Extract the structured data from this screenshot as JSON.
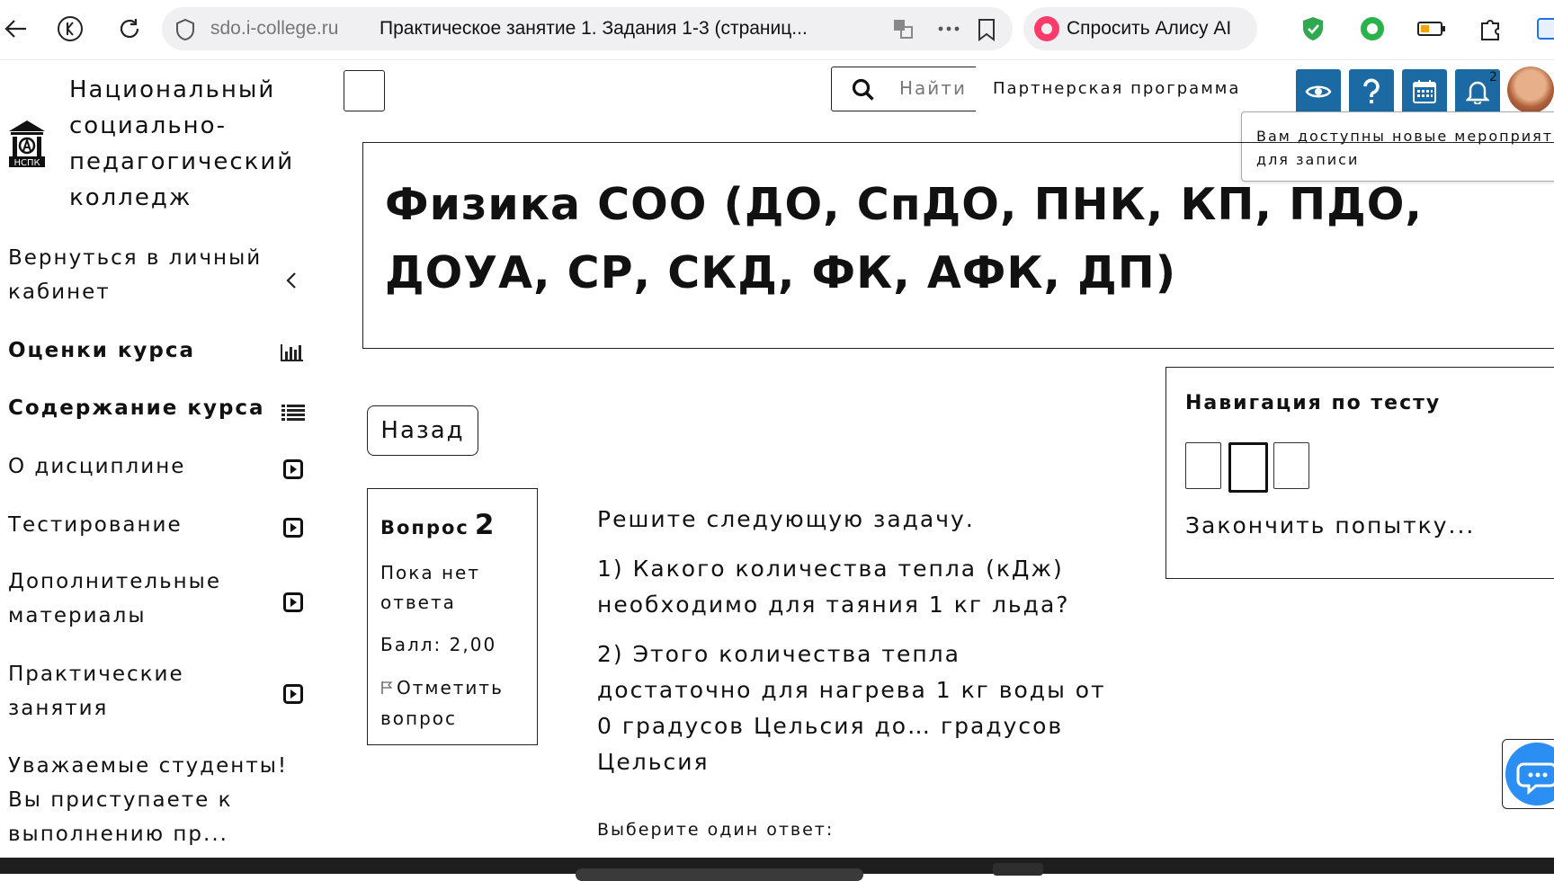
{
  "browser": {
    "domain": "sdo.i-college.ru",
    "tab_title": "Практическое занятие 1. Задания 1-3 (страниц...",
    "alice_label": "Спросить Алису AI"
  },
  "sidebar": {
    "org_name": "Национальный социально-педагогический колледж",
    "logo_text": "НСПК",
    "items": [
      {
        "label": "Вернуться в личный кабинет",
        "icon": "chevron-left-icon"
      },
      {
        "label": "Оценки курса",
        "icon": "bar-chart-icon"
      },
      {
        "label": "Содержание курса",
        "icon": "list-icon"
      },
      {
        "label": "О дисциплине",
        "icon": "play-square-icon"
      },
      {
        "label": "Тестирование",
        "icon": "play-square-icon"
      },
      {
        "label": "Дополнительные материалы",
        "icon": "play-square-icon"
      },
      {
        "label": "Практические занятия",
        "icon": "play-square-icon"
      },
      {
        "label": "Уважаемые студенты! Вы приступаете к выполнению пр...",
        "icon": ""
      }
    ]
  },
  "header": {
    "search_placeholder": "Найти",
    "partner_link": "Партнерская программа",
    "notification_count": "2",
    "tooltip": "Вам доступны новые мероприят\nдля записи",
    "tool_color": "#1c6aa3"
  },
  "course": {
    "title": "Физика СОО (ДО, СпДО, ПНК, КП, ПДО, ДОУА, СР, СКД, ФК, АФК, ДП)"
  },
  "back_button": "Назад",
  "question": {
    "label": "Вопрос",
    "number": "2",
    "status": "Пока нет ответа",
    "score": "Балл: 2,00",
    "flag_label": "Отметить вопрос",
    "intro": "Решите следующую задачу.",
    "part1": "1) Какого количества тепла (кДж) необходимо для таяния 1 кг льда?",
    "part2": "2) Этого количества тепла достаточно для нагрева 1 кг воды от 0 градусов Цельсия до… градусов Цельсия",
    "choose_prompt": "Выберите один ответ:"
  },
  "test_nav": {
    "title": "Навигация по тесту",
    "finish": "Закончить попытку...",
    "current_index": 2
  }
}
